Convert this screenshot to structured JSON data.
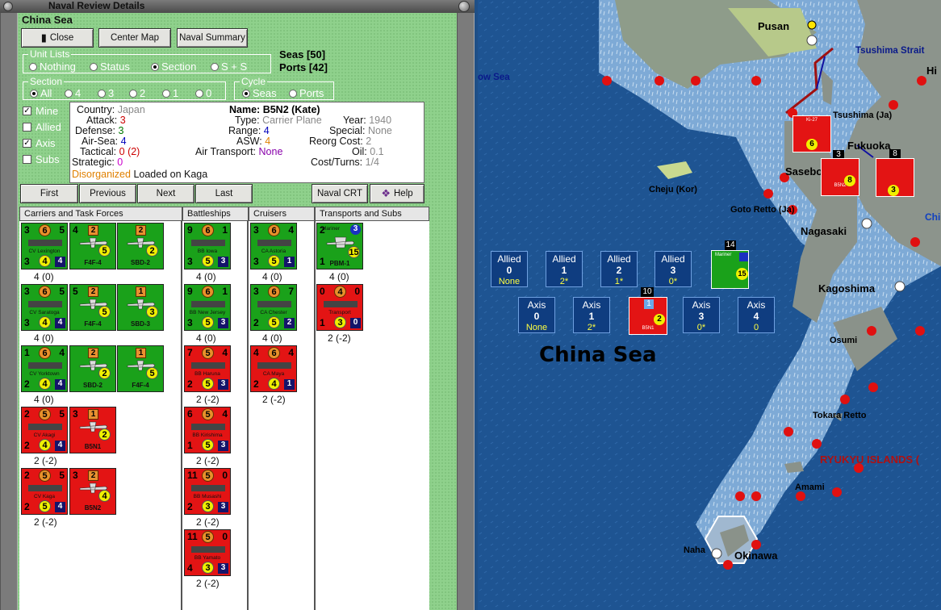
{
  "window": {
    "title": "Naval Review Details"
  },
  "header": "China Sea",
  "toolbar": {
    "close": "Close",
    "center_map": "Center Map",
    "naval_summary": "Naval Summary"
  },
  "counts": {
    "seas": "Seas [50]",
    "ports": "Ports [42]"
  },
  "unit_lists": {
    "title": "Unit Lists",
    "options": [
      "Nothing",
      "Status",
      "Section",
      "S + S"
    ],
    "selected": "Section"
  },
  "section": {
    "title": "Section",
    "options": [
      "All",
      "4",
      "3",
      "2",
      "1",
      "0"
    ],
    "selected": "All"
  },
  "cycle": {
    "title": "Cycle",
    "options": [
      "Seas",
      "Ports"
    ],
    "selected": "Seas"
  },
  "filters": [
    {
      "label": "Mine",
      "checked": true
    },
    {
      "label": "Allied",
      "checked": false
    },
    {
      "label": "Axis",
      "checked": true
    },
    {
      "label": "Subs",
      "checked": false
    }
  ],
  "info": {
    "country_label": "Country:",
    "country": "Japan",
    "attack_label": "Attack:",
    "attack": "3",
    "defense_label": "Defense:",
    "defense": "3",
    "airsea_label": "Air-Sea:",
    "airsea": "4",
    "tactical_label": "Tactical:",
    "tactical": "0 (2)",
    "strategic_label": "Strategic:",
    "strategic": "0",
    "disorganized": "Disorganized",
    "loaded": "Loaded on Kaga",
    "name_label": "Name:",
    "name": "B5N2 (Kate)",
    "type_label": "Type:",
    "type": "Carrier Plane",
    "range_label": "Range:",
    "range": "4",
    "asw_label": "ASW:",
    "asw": "4",
    "air_transport_label": "Air Transport:",
    "air_transport": "None",
    "year_label": "Year:",
    "year": "1940",
    "special_label": "Special:",
    "special": "None",
    "reorg_label": "Reorg Cost:",
    "reorg": "2",
    "oil_label": "Oil:",
    "oil": "0.1",
    "cost_label": "Cost/Turns:",
    "cost": "1/4"
  },
  "nav": {
    "first": "First",
    "previous": "Previous",
    "next": "Next",
    "last": "Last",
    "crt": "Naval CRT",
    "help": "Help"
  },
  "columns": [
    "Carriers and Task Forces",
    "Battleships",
    "Cruisers",
    "Transports and Subs"
  ],
  "carriers": [
    {
      "name": "CV Lexington",
      "side": "g",
      "a": "3",
      "b": "6",
      "c": "5",
      "d": "3",
      "e": "4",
      "f": "4",
      "strength": "4 (0)",
      "planes": [
        {
          "name": "F4F-4",
          "a": "4",
          "b": "2",
          "c": "5",
          "side": "g"
        },
        {
          "name": "SBD-2",
          "a": "",
          "b": "2",
          "c": "2",
          "side": "g"
        }
      ]
    },
    {
      "name": "CV Saratoga",
      "side": "g",
      "a": "3",
      "b": "6",
      "c": "5",
      "d": "3",
      "e": "4",
      "f": "4",
      "strength": "4 (0)",
      "planes": [
        {
          "name": "F4F-4",
          "a": "5",
          "b": "2",
          "c": "5",
          "side": "g"
        },
        {
          "name": "SBD-3",
          "a": "",
          "b": "1",
          "c": "3",
          "side": "g"
        }
      ]
    },
    {
      "name": "CV Yorktown",
      "side": "g",
      "a": "1",
      "b": "6",
      "c": "4",
      "d": "2",
      "e": "4",
      "f": "4",
      "strength": "4 (0)",
      "planes": [
        {
          "name": "SBD-2",
          "a": "",
          "b": "2",
          "c": "2",
          "side": "g"
        },
        {
          "name": "F4F-4",
          "a": "",
          "b": "1",
          "c": "5",
          "side": "g"
        }
      ]
    },
    {
      "name": "CV Akagi",
      "side": "r",
      "a": "2",
      "b": "5",
      "c": "5",
      "d": "2",
      "e": "4",
      "f": "4",
      "strength": "2 (-2)",
      "planes": [
        {
          "name": "B5N1",
          "a": "3",
          "b": "1",
          "c": "2",
          "side": "r"
        }
      ]
    },
    {
      "name": "CV Kaga",
      "side": "r",
      "a": "2",
      "b": "5",
      "c": "5",
      "d": "2",
      "e": "5",
      "f": "4",
      "strength": "2 (-2)",
      "planes": [
        {
          "name": "B5N2",
          "a": "3",
          "b": "2",
          "c": "4",
          "side": "r"
        }
      ]
    }
  ],
  "battleships": [
    {
      "name": "BB Iowa",
      "side": "g",
      "a": "9",
      "b": "6",
      "c": "1",
      "d": "3",
      "e": "5",
      "f": "3",
      "strength": "4 (0)"
    },
    {
      "name": "BB New Jersey",
      "side": "g",
      "a": "9",
      "b": "6",
      "c": "1",
      "d": "3",
      "e": "5",
      "f": "3",
      "strength": "4 (0)"
    },
    {
      "name": "BB Haruna",
      "side": "r",
      "a": "7",
      "b": "5",
      "c": "4",
      "d": "2",
      "e": "5",
      "f": "3",
      "strength": "2 (-2)"
    },
    {
      "name": "BB Kirishima",
      "side": "r",
      "a": "6",
      "b": "5",
      "c": "4",
      "d": "1",
      "e": "5",
      "f": "3",
      "strength": "2 (-2)"
    },
    {
      "name": "BB Musashi",
      "side": "r",
      "a": "11",
      "b": "5",
      "c": "0",
      "d": "2",
      "e": "3",
      "f": "3",
      "strength": "2 (-2)"
    },
    {
      "name": "BB Yamato",
      "side": "r",
      "a": "11",
      "b": "5",
      "c": "0",
      "d": "4",
      "e": "3",
      "f": "3",
      "strength": "2 (-2)"
    }
  ],
  "cruisers": [
    {
      "name": "CA Astoria",
      "side": "g",
      "a": "3",
      "b": "6",
      "c": "4",
      "d": "3",
      "e": "5",
      "f": "1",
      "strength": "4 (0)"
    },
    {
      "name": "CA Chester",
      "side": "g",
      "a": "3",
      "b": "6",
      "c": "7",
      "d": "2",
      "e": "5",
      "f": "2",
      "strength": "4 (0)"
    },
    {
      "name": "CA Maya",
      "side": "r",
      "a": "4",
      "b": "6",
      "c": "4",
      "d": "2",
      "e": "4",
      "f": "1",
      "strength": "2 (-2)"
    }
  ],
  "transports": [
    {
      "name": "PBM-1",
      "top": "Mariner",
      "side": "g",
      "a": "2",
      "b": "3",
      "c": "15",
      "d": "1",
      "strength": "4 (0)"
    },
    {
      "name": "Transport",
      "side": "r",
      "a": "0",
      "b": "4",
      "c": "0",
      "d": "1",
      "e": "3",
      "f": "0",
      "strength": "2 (-2)"
    }
  ],
  "map": {
    "sea_name": "China Sea",
    "labels": [
      "Pusan",
      "Tsushima Strait",
      "Tsushima (Ja)",
      "Fukuoka",
      "Sasebo",
      "Cheju (Kor)",
      "Goto Retto (Ja)",
      "Nagasaki",
      "Kagoshima",
      "Osumi",
      "Tokara Retto",
      "RYUKYU ISLANDS (",
      "Amami",
      "Naha",
      "Okinawa",
      "ow Sea",
      "Hi",
      "Chi"
    ],
    "allied_boxes": [
      {
        "label": "Allied",
        "num": "0",
        "sub": "None"
      },
      {
        "label": "Allied",
        "num": "1",
        "sub": "2*"
      },
      {
        "label": "Allied",
        "num": "2",
        "sub": "1*"
      },
      {
        "label": "Allied",
        "num": "3",
        "sub": "0*"
      }
    ],
    "axis_boxes": [
      {
        "label": "Axis",
        "num": "0",
        "sub": "None"
      },
      {
        "label": "Axis",
        "num": "1",
        "sub": "2*"
      },
      {
        "label": "Axis",
        "num": "3",
        "sub": "0*"
      },
      {
        "label": "Axis",
        "num": "4",
        "sub": "0"
      }
    ],
    "stack_counts": [
      "14",
      "10",
      "3",
      "8"
    ],
    "map_units": [
      "Ki-27",
      "B5N2",
      "Mariner",
      "B5N1"
    ]
  },
  "colors": {
    "allied_green": "#1aa11a",
    "axis_red": "#e31414",
    "panel_green": "#8fd18c",
    "sea": "#1d5290"
  }
}
